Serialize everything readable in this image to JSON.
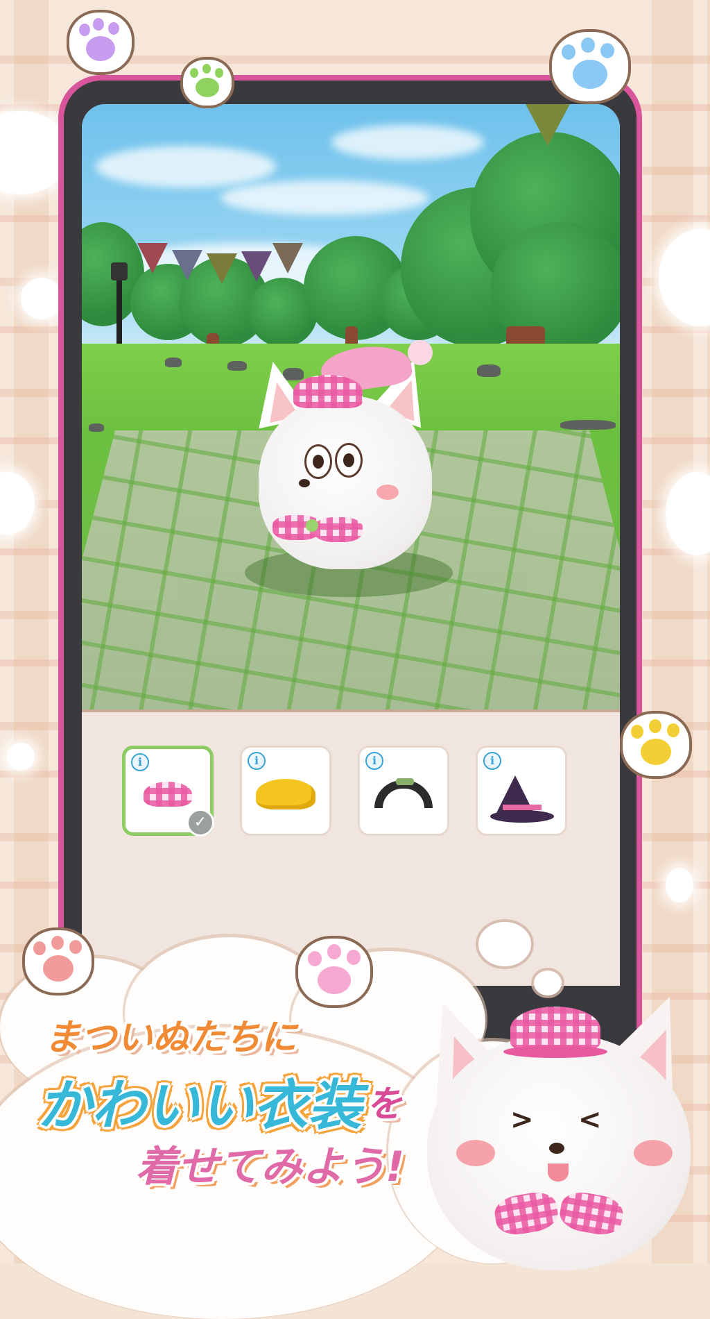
{
  "promo": {
    "line1": "まついぬたちに",
    "line2_highlight": "かわいい衣装",
    "line2_particle": "を",
    "line3": "着せてみよう!"
  },
  "wardrobe": {
    "items": [
      {
        "name": "pink-checkered-cap",
        "info_label": "i",
        "selected": true,
        "color": "#ea5aa3"
      },
      {
        "name": "yellow-school-hat",
        "info_label": "i",
        "selected": false,
        "color": "#f5c51f"
      },
      {
        "name": "black-hair-buns",
        "info_label": "i",
        "selected": false,
        "color": "#2b2b2b"
      },
      {
        "name": "purple-witch-hat",
        "info_label": "i",
        "selected": false,
        "color": "#3d2a4d"
      }
    ]
  },
  "colors": {
    "frame_pink": "#d8559b",
    "frame_dark": "#3a3a3e",
    "panel_bg": "#f1e6df",
    "selected_border": "#8ccc63",
    "info_blue": "#3aa1d6"
  }
}
